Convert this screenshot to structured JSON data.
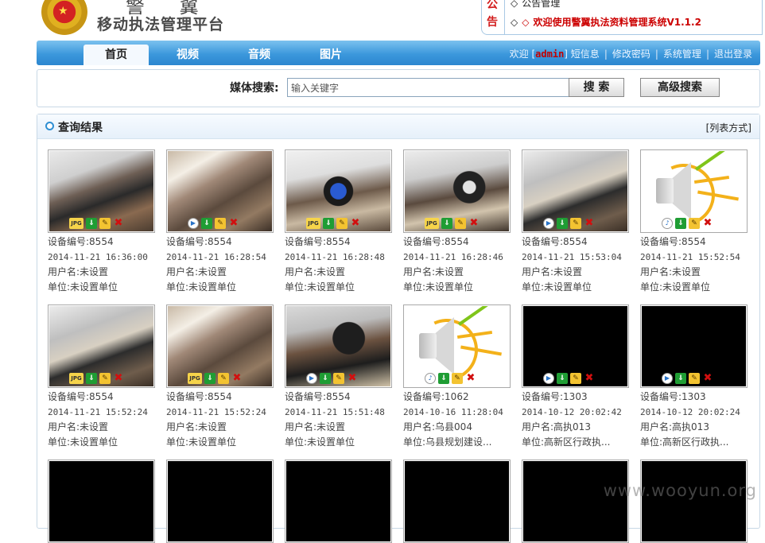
{
  "header": {
    "brand_top": "警 翼",
    "brand_title": "移动执法管理平台",
    "notice_label": "公告",
    "notice_line1": "公告管理",
    "notice_line2": "欢迎使用警翼执法资料管理系统V1.1.2"
  },
  "nav": {
    "tabs": [
      "首页",
      "视频",
      "音频",
      "图片"
    ],
    "active_tab": "首页",
    "welcome": "欢迎",
    "user": "admin",
    "links": [
      "短信息",
      "修改密码",
      "系统管理",
      "退出登录"
    ]
  },
  "search": {
    "label": "媒体搜索:",
    "placeholder": "输入关键字",
    "search_button": "搜 索",
    "advanced_button": "高级搜索"
  },
  "results": {
    "title": "查询结果",
    "list_mode": "[列表方式]",
    "items": [
      {
        "type": "image",
        "device": "设备编号:8554",
        "time": "2014-11-21 16:36:00",
        "user": "用户名:未设置",
        "unit": "单位:未设置单位"
      },
      {
        "type": "video",
        "device": "设备编号:8554",
        "time": "2014-11-21 16:28:54",
        "user": "用户名:未设置",
        "unit": "单位:未设置单位"
      },
      {
        "type": "image",
        "device": "设备编号:8554",
        "time": "2014-11-21 16:28:48",
        "user": "用户名:未设置",
        "unit": "单位:未设置单位"
      },
      {
        "type": "image",
        "device": "设备编号:8554",
        "time": "2014-11-21 16:28:46",
        "user": "用户名:未设置",
        "unit": "单位:未设置单位"
      },
      {
        "type": "video",
        "device": "设备编号:8554",
        "time": "2014-11-21 15:53:04",
        "user": "用户名:未设置",
        "unit": "单位:未设置单位"
      },
      {
        "type": "audio",
        "device": "设备编号:8554",
        "time": "2014-11-21 15:52:54",
        "user": "用户名:未设置",
        "unit": "单位:未设置单位"
      },
      {
        "type": "image",
        "device": "设备编号:8554",
        "time": "2014-11-21 15:52:24",
        "user": "用户名:未设置",
        "unit": "单位:未设置单位"
      },
      {
        "type": "image",
        "device": "设备编号:8554",
        "time": "2014-11-21 15:52:24",
        "user": "用户名:未设置",
        "unit": "单位:未设置单位"
      },
      {
        "type": "video",
        "device": "设备编号:8554",
        "time": "2014-11-21 15:51:48",
        "user": "用户名:未设置",
        "unit": "单位:未设置单位"
      },
      {
        "type": "audio",
        "device": "设备编号:1062",
        "time": "2014-10-16 11:28:04",
        "user": "用户名:乌县004",
        "unit": "单位:乌县规划建设..."
      },
      {
        "type": "video",
        "device": "设备编号:1303",
        "time": "2014-10-12 20:02:42",
        "user": "用户名:高执013",
        "unit": "单位:高新区行政执..."
      },
      {
        "type": "video",
        "device": "设备编号:1303",
        "time": "2014-10-12 20:02:24",
        "user": "用户名:高执013",
        "unit": "单位:高新区行政执..."
      }
    ]
  },
  "watermark": "www.wooyun.org",
  "colors": {
    "nav_blue": "#3c98dc",
    "notice_red": "#cc0000",
    "panel_border": "#c8d8e6"
  }
}
